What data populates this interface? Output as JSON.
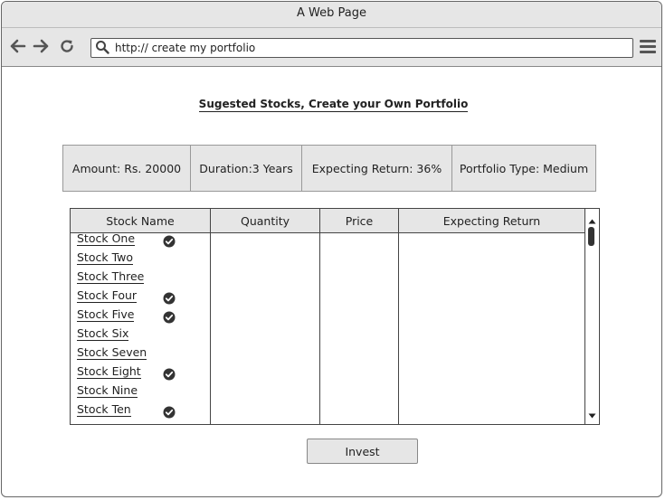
{
  "window": {
    "title": "A Web Page"
  },
  "browser": {
    "url": "http://  create my portfolio"
  },
  "heading": "Sugested Stocks, Create your Own Portfolio",
  "summary": [
    "Amount: Rs. 20000",
    "Duration:3 Years",
    "Expecting Return: 36%",
    "Portfolio Type: Medium"
  ],
  "table": {
    "columns": [
      "Stock Name",
      "Quantity",
      "Price",
      "Expecting Return"
    ],
    "rows": [
      {
        "name": "Stock One",
        "checked": true
      },
      {
        "name": "Stock Two",
        "checked": false
      },
      {
        "name": "Stock Three",
        "checked": false
      },
      {
        "name": "Stock Four",
        "checked": true
      },
      {
        "name": "Stock Five",
        "checked": true
      },
      {
        "name": "Stock Six",
        "checked": false
      },
      {
        "name": "Stock Seven",
        "checked": false
      },
      {
        "name": "Stock Eight",
        "checked": true
      },
      {
        "name": "Stock Nine",
        "checked": false
      },
      {
        "name": "Stock Ten",
        "checked": true
      }
    ]
  },
  "invest_label": "Invest",
  "icons": [
    "back-arrow-icon",
    "forward-arrow-icon",
    "refresh-icon",
    "search-icon",
    "hamburger-menu-icon",
    "check-circle-icon",
    "scroll-up-icon",
    "scroll-down-icon"
  ]
}
